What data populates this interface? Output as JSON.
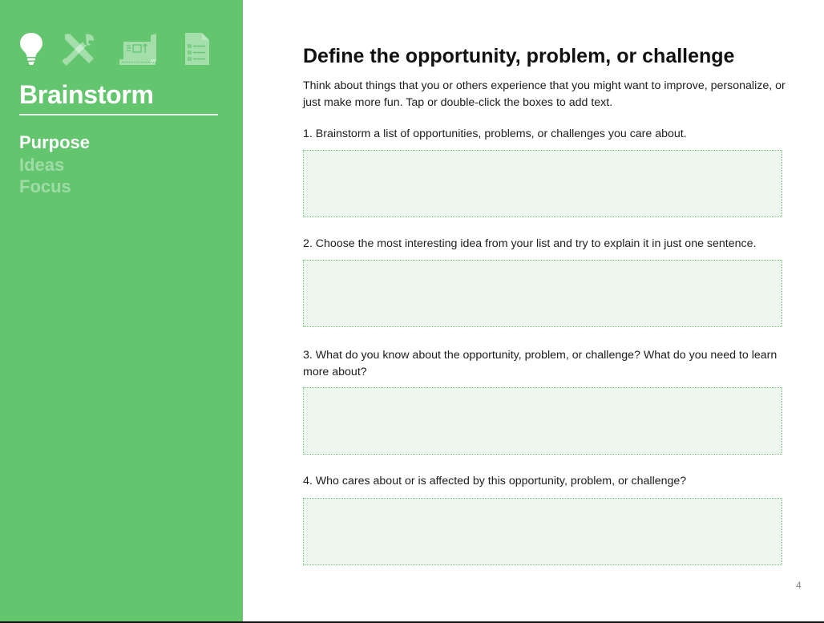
{
  "sidebar": {
    "icons": [
      "lightbulb-icon",
      "tools-icon",
      "blueprint-icon",
      "checklist-icon"
    ],
    "title": "Brainstorm",
    "nav": [
      {
        "label": "Purpose",
        "active": true
      },
      {
        "label": "Ideas",
        "active": false
      },
      {
        "label": "Focus",
        "active": false
      }
    ],
    "color": "#63c66f"
  },
  "main": {
    "title": "Define the opportunity, problem, or challenge",
    "intro": "Think about things that you or others experience that you might want to improve, personalize, or just make more fun. Tap or double-click the boxes to add text.",
    "questions": [
      {
        "text": "1. Brainstorm a list of opportunities, problems, or challenges you care about.",
        "answer": ""
      },
      {
        "text": "2. Choose the most interesting idea from your list and try to explain it in just one sentence.",
        "answer": ""
      },
      {
        "text": "3. What do you know about the opportunity, problem, or challenge? What do you need to learn more about?",
        "answer": ""
      },
      {
        "text": "4. Who cares about or is affected by this opportunity, problem, or challenge?",
        "answer": ""
      }
    ],
    "box_fill": "#eef7ee",
    "box_border": "#72c77b"
  },
  "page_number": "4"
}
